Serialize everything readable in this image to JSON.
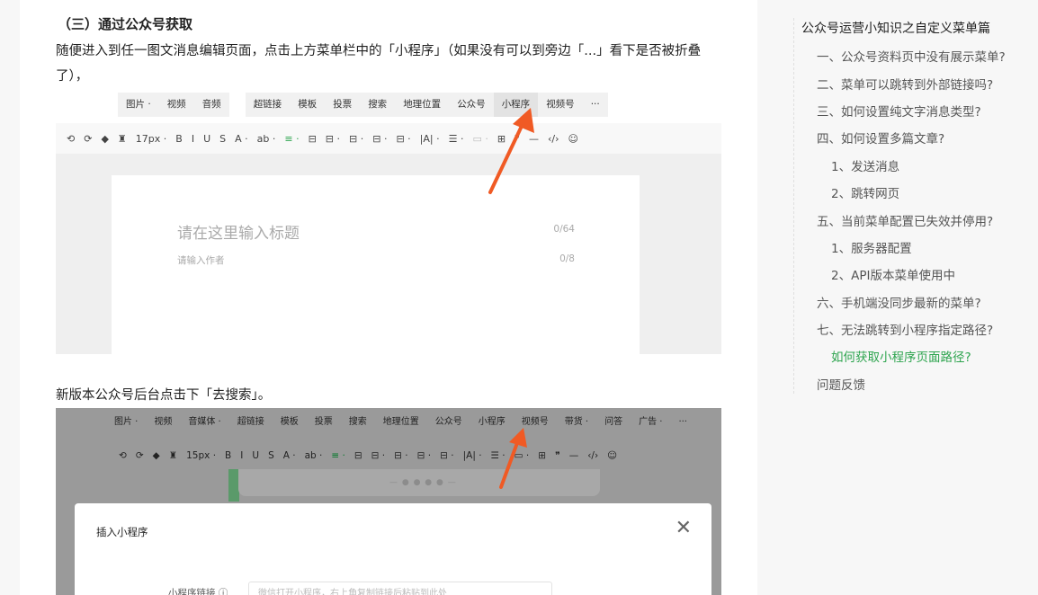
{
  "article": {
    "section_heading": "（三）通过公众号获取",
    "paragraph1": "随便进入到任一图文消息编辑页面，点击上方菜单栏中的「小程序」（如果没有可以到旁边「...」看下是否被折叠了），",
    "paragraph2": "新版本公众号后台点击下「去搜索」。"
  },
  "screenshot1": {
    "menu_group1": [
      "图片 ·",
      "视频",
      "音频"
    ],
    "menu_group2": [
      "超链接",
      "模板",
      "投票",
      "搜索",
      "地理位置",
      "公众号",
      "小程序",
      "视频号",
      "···"
    ],
    "active_menu": "小程序",
    "toolbar": [
      "⟲",
      "⟳",
      "◆",
      "♜",
      "17px ·",
      "B",
      "I",
      "U",
      "S",
      "A ·",
      "ab ·",
      "≡ ·",
      "⊟",
      "⊟ ·",
      "⊟ ·",
      "⊟ ·",
      "⊟ ·",
      "|A| ·",
      "☰ ·",
      "▭ ·",
      "⊞",
      "❞",
      "—",
      "‹/›",
      "☺"
    ],
    "title_placeholder": "请在这里输入标题",
    "title_count": "0/64",
    "author_placeholder": "请输入作者",
    "author_count": "0/8"
  },
  "screenshot2": {
    "menu": [
      "图片 ·",
      "视频",
      "音媒体 ·",
      "超链接",
      "模板",
      "投票",
      "搜索",
      "地理位置",
      "公众号",
      "小程序",
      "视频号",
      "带货 ·",
      "问答",
      "广告 ·",
      "···"
    ],
    "toolbar": [
      "⟲",
      "⟳",
      "◆",
      "♜",
      "15px ·",
      "B",
      "I",
      "U",
      "S",
      "A ·",
      "ab ·",
      "≡ ·",
      "⊟",
      "⊟ ·",
      "⊟ ·",
      "⊟ ·",
      "⊟ ·",
      "|A| ·",
      "☰ ·",
      "▭ ·",
      "⊞",
      "❞",
      "—",
      "‹/›",
      "☺"
    ],
    "popup_dots": "— ● ● ● ● —",
    "dialog_title": "插入小程序",
    "dialog_close": "✕",
    "field_label": "小程序链接 ⓘ",
    "field_placeholder": "微信打开小程序，右上角复制链接后粘贴到此处"
  },
  "toc": {
    "title": "公众号运营小知识之自定义菜单篇",
    "items": [
      {
        "label": "一、公众号资料页中没有展示菜单?"
      },
      {
        "label": "二、菜单可以跳转到外部链接吗?"
      },
      {
        "label": "三、如何设置纯文字消息类型?"
      },
      {
        "label": "四、如何设置多篇文章?"
      },
      {
        "label": "1、发送消息"
      },
      {
        "label": "2、跳转网页"
      },
      {
        "label": "五、当前菜单配置已失效并停用?"
      },
      {
        "label": "1、服务器配置"
      },
      {
        "label": "2、API版本菜单使用中"
      },
      {
        "label": "六、手机端没同步最新的菜单?"
      },
      {
        "label": "七、无法跳转到小程序指定路径?"
      },
      {
        "label": "如何获取小程序页面路径?"
      },
      {
        "label": "问题反馈"
      }
    ],
    "active_index": 11,
    "active_color": "#2da44e"
  },
  "colors": {
    "arrow": "#f05a24",
    "accent_green": "#2da44e"
  }
}
